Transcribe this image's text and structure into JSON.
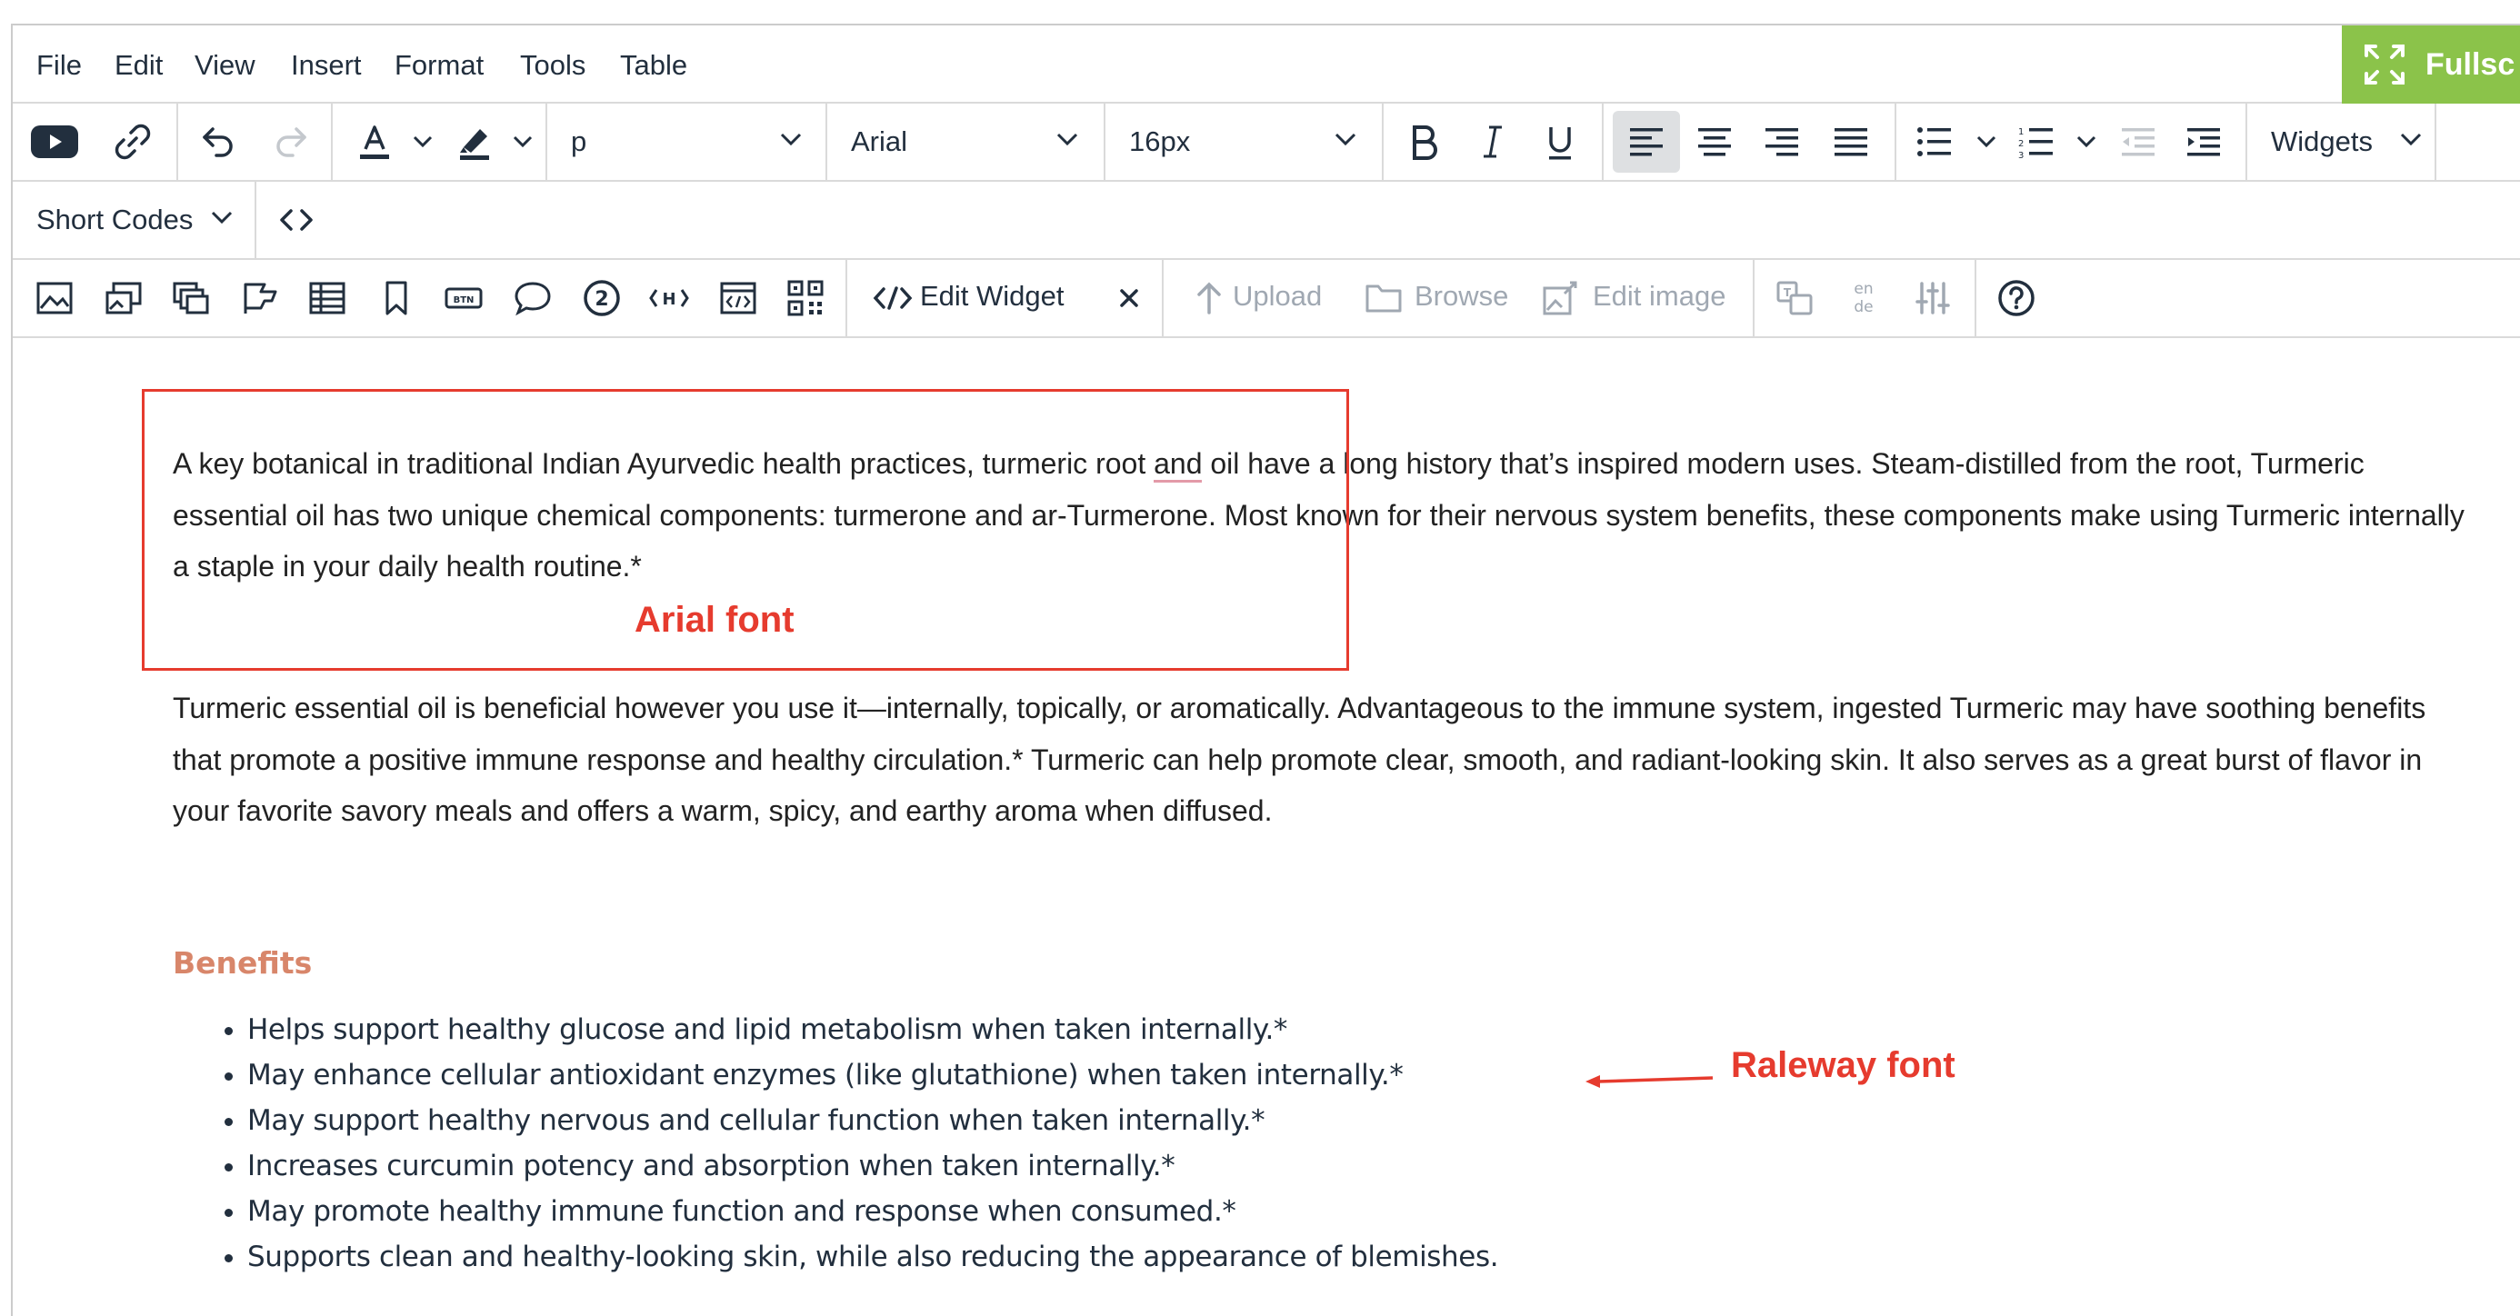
{
  "menubar": {
    "items": [
      "File",
      "Edit",
      "View",
      "Insert",
      "Format",
      "Tools",
      "Table"
    ],
    "fullscreen_label": "Fullsc"
  },
  "toolbar": {
    "block_format": "p",
    "font_family": "Arial",
    "font_size": "16px",
    "widgets_label": "Widgets",
    "short_codes_label": "Short Codes",
    "edit_widget_label": "Edit Widget",
    "upload_label": "Upload",
    "browse_label": "Browse",
    "edit_image_label": "Edit image",
    "translate_small": "en",
    "translate_small2": "de"
  },
  "content": {
    "p1_before": "A key botanical in traditional Indian Ayurvedic health practices, turmeric root ",
    "p1_spell": "and",
    "p1_after": " oil have a long history that’s inspired modern uses. Steam-distilled from the root, Turmeric essential oil has two unique chemical components: turmerone and ar-Turmerone. Most known for their nervous system benefits, these components make using Turmeric internally a staple in your daily health routine.*",
    "p2": "Turmeric essential oil is beneficial however you use it—internally, topically, or aromatically. Advantageous to the immune system, ingested Turmeric may have soothing benefits that promote a positive immune response and healthy circulation.* Turmeric can help promote clear, smooth, and radiant-looking skin. It also serves as a great burst of flavor in your favorite savory meals and offers a warm, spicy, and earthy aroma when diffused.",
    "benefits_heading": "Benefits",
    "benefits": [
      "Helps support healthy glucose and lipid metabolism when taken internally.*",
      "May enhance cellular antioxidant enzymes (like glutathione) when taken internally.*",
      "May support healthy nervous and cellular function when taken internally.*",
      "Increases curcumin potency and absorption when taken internally.*",
      "May promote healthy immune function and response when consumed.*",
      "Supports clean and healthy-looking skin, while also reducing the appearance of blemishes."
    ]
  },
  "annotations": {
    "arial_label": "Arial font",
    "raleway_label": "Raleway font"
  },
  "colors": {
    "annotation": "#e63b2e",
    "fullscreen": "#8bc34a",
    "benefits_heading": "#d8866a",
    "active_button": "#dee0e2"
  }
}
